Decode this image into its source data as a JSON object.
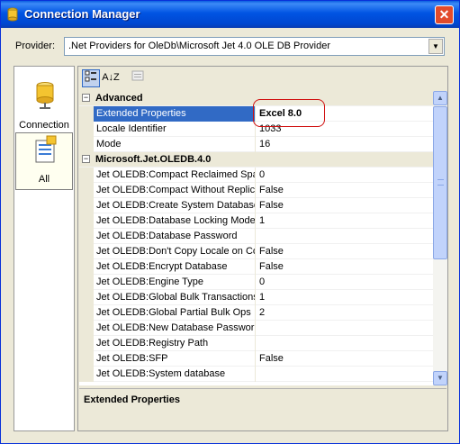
{
  "window": {
    "title": "Connection Manager",
    "close_glyph": "✕"
  },
  "provider": {
    "label": "Provider:",
    "value": ".Net Providers for OleDb\\Microsoft Jet 4.0 OLE DB Provider"
  },
  "nav": {
    "items": [
      {
        "label": "Connection",
        "icon": "database-icon"
      },
      {
        "label": "All",
        "icon": "all-properties-icon"
      }
    ]
  },
  "toolbar": {
    "categorized": "categorized-icon",
    "alphabetical_glyph": "A↓Z",
    "pages": "property-pages-icon"
  },
  "grid": {
    "categories": [
      {
        "name": "Advanced",
        "rows": [
          {
            "name": "Extended Properties",
            "value": "Excel 8.0"
          },
          {
            "name": "Locale Identifier",
            "value": "1033"
          },
          {
            "name": "Mode",
            "value": "16"
          }
        ]
      },
      {
        "name": "Microsoft.Jet.OLEDB.4.0",
        "rows": [
          {
            "name": "Jet OLEDB:Compact Reclaimed Space",
            "value": "0"
          },
          {
            "name": "Jet OLEDB:Compact Without Replica",
            "value": "False"
          },
          {
            "name": "Jet OLEDB:Create System Database",
            "value": "False"
          },
          {
            "name": "Jet OLEDB:Database Locking Mode",
            "value": "1"
          },
          {
            "name": "Jet OLEDB:Database Password",
            "value": ""
          },
          {
            "name": "Jet OLEDB:Don't Copy Locale on Com",
            "value": "False"
          },
          {
            "name": "Jet OLEDB:Encrypt Database",
            "value": "False"
          },
          {
            "name": "Jet OLEDB:Engine Type",
            "value": "0"
          },
          {
            "name": "Jet OLEDB:Global Bulk Transactions",
            "value": "1"
          },
          {
            "name": "Jet OLEDB:Global Partial Bulk Ops",
            "value": "2"
          },
          {
            "name": "Jet OLEDB:New Database Password",
            "value": ""
          },
          {
            "name": "Jet OLEDB:Registry Path",
            "value": ""
          },
          {
            "name": "Jet OLEDB:SFP",
            "value": "False"
          },
          {
            "name": "Jet OLEDB:System database",
            "value": ""
          }
        ]
      }
    ],
    "selected": "Extended Properties"
  },
  "description": {
    "title": "Extended Properties"
  },
  "colors": {
    "selection": "#316ac5",
    "highlight_ring": "#d01010",
    "title_bar": "#0054e3"
  }
}
